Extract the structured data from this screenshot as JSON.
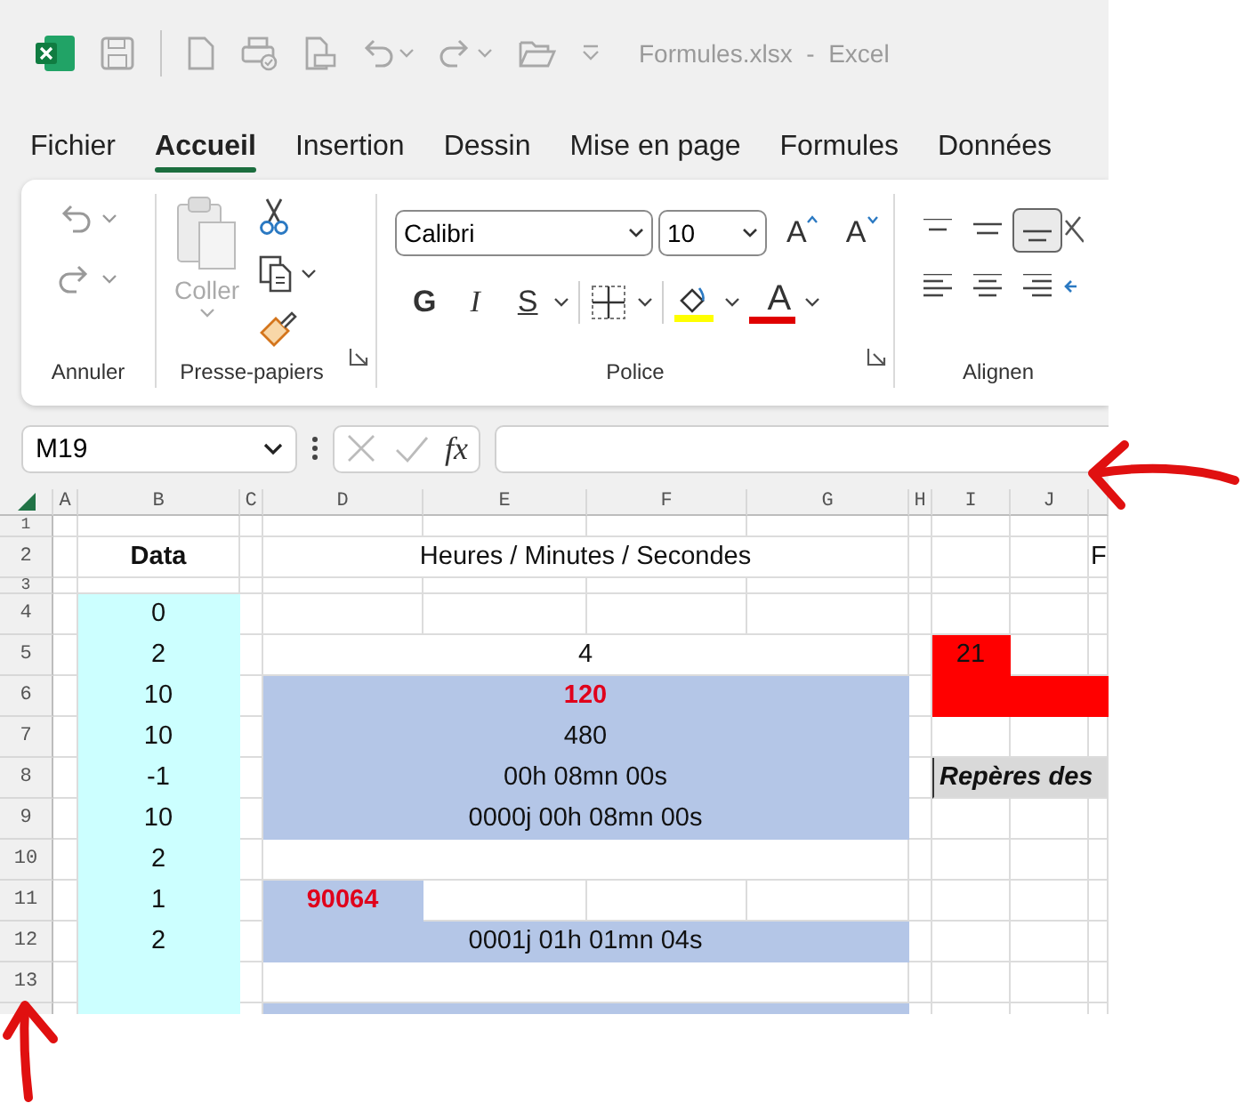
{
  "window": {
    "title": "Formules.xlsx  -  Excel"
  },
  "tabs": [
    {
      "label": "Fichier",
      "selected": false
    },
    {
      "label": "Accueil",
      "selected": true
    },
    {
      "label": "Insertion",
      "selected": false
    },
    {
      "label": "Dessin",
      "selected": false
    },
    {
      "label": "Mise en page",
      "selected": false
    },
    {
      "label": "Formules",
      "selected": false
    },
    {
      "label": "Données",
      "selected": false
    }
  ],
  "ribbon": {
    "undo": {
      "label": "Annuler"
    },
    "clipboard": {
      "label": "Presse-papiers",
      "paste": "Coller"
    },
    "font": {
      "label": "Police",
      "font_name": "Calibri",
      "font_size": "10",
      "grow": "A",
      "shrink": "A",
      "bold": "G",
      "italic": "I",
      "underline": "S",
      "font_color_letter": "A"
    },
    "alignment": {
      "label": "Alignen",
      "bottom_aligned": true
    }
  },
  "formula_bar": {
    "name_box": "M19",
    "fx": "fx"
  },
  "sheet": {
    "columns": [
      "A",
      "B",
      "C",
      "D",
      "E",
      "F",
      "G",
      "H",
      "I",
      "J"
    ],
    "rows": [
      {
        "label": "1",
        "kind": "compact",
        "cells": [
          {
            "kind": "empty"
          },
          {
            "kind": "empty"
          },
          {
            "kind": "empty"
          },
          {
            "kind": "empty"
          },
          {
            "kind": "empty"
          },
          {
            "kind": "empty"
          },
          {
            "kind": "empty"
          },
          {
            "kind": "empty"
          },
          {
            "kind": "empty"
          },
          {
            "kind": "empty"
          },
          {
            "kind": "empty"
          }
        ]
      },
      {
        "label": "2",
        "kind": "regular",
        "cells": [
          {
            "kind": "empty"
          },
          {
            "kind": "text",
            "text": "Data",
            "bold": true
          },
          {
            "kind": "empty"
          },
          {
            "kind": "text",
            "text": "Heures / Minutes / Secondes"
          },
          {
            "kind": "merged"
          },
          {
            "kind": "merged"
          },
          {
            "kind": "merged"
          },
          {
            "kind": "empty"
          },
          {
            "kind": "empty"
          },
          {
            "kind": "empty"
          },
          {
            "kind": "text",
            "text": "F",
            "left_aligned": true
          }
        ]
      },
      {
        "label": "3",
        "kind": "compact",
        "cells": [
          {
            "kind": "empty"
          },
          {
            "kind": "empty"
          },
          {
            "kind": "empty"
          },
          {
            "kind": "empty"
          },
          {
            "kind": "empty"
          },
          {
            "kind": "empty"
          },
          {
            "kind": "empty"
          },
          {
            "kind": "empty"
          },
          {
            "kind": "empty"
          },
          {
            "kind": "empty"
          },
          {
            "kind": "empty"
          }
        ]
      },
      {
        "label": "4",
        "kind": "regular",
        "cells": [
          {
            "kind": "empty"
          },
          {
            "kind": "text",
            "text": "0",
            "color": "#ccffff"
          },
          {
            "kind": "empty"
          },
          {
            "kind": "empty"
          },
          {
            "kind": "empty"
          },
          {
            "kind": "empty"
          },
          {
            "kind": "empty"
          },
          {
            "kind": "empty"
          },
          {
            "kind": "empty"
          },
          {
            "kind": "empty"
          },
          {
            "kind": "empty"
          }
        ]
      },
      {
        "label": "5",
        "kind": "regular",
        "cells": [
          {
            "kind": "empty"
          },
          {
            "kind": "text",
            "text": "2",
            "color": "#ccffff"
          },
          {
            "kind": "empty"
          },
          {
            "kind": "text",
            "text": "4"
          },
          {
            "kind": "merged"
          },
          {
            "kind": "merged"
          },
          {
            "kind": "merged"
          },
          {
            "kind": "empty"
          },
          {
            "kind": "text",
            "text": "21",
            "color": "#ff0000"
          },
          {
            "kind": "empty"
          },
          {
            "kind": "empty"
          }
        ]
      },
      {
        "label": "6",
        "kind": "regular",
        "cells": [
          {
            "kind": "empty"
          },
          {
            "kind": "text",
            "text": "10",
            "color": "#ccffff"
          },
          {
            "kind": "empty"
          },
          {
            "kind": "text",
            "text": "120",
            "color": "#b4c6e7",
            "bold": true,
            "highlighted": true
          },
          {
            "kind": "merged"
          },
          {
            "kind": "merged"
          },
          {
            "kind": "merged"
          },
          {
            "kind": "empty"
          },
          {
            "kind": "fill",
            "color": "#ff0000"
          },
          {
            "kind": "merged"
          },
          {
            "kind": "merged"
          }
        ]
      },
      {
        "label": "7",
        "kind": "regular",
        "cells": [
          {
            "kind": "empty"
          },
          {
            "kind": "text",
            "text": "10",
            "color": "#ccffff"
          },
          {
            "kind": "empty"
          },
          {
            "kind": "text",
            "text": "480",
            "color": "#b4c6e7"
          },
          {
            "kind": "merged"
          },
          {
            "kind": "merged"
          },
          {
            "kind": "merged"
          },
          {
            "kind": "empty"
          },
          {
            "kind": "empty"
          },
          {
            "kind": "empty"
          },
          {
            "kind": "empty"
          }
        ]
      },
      {
        "label": "8",
        "kind": "regular",
        "cells": [
          {
            "kind": "empty"
          },
          {
            "kind": "text",
            "text": "-1",
            "color": "#ccffff"
          },
          {
            "kind": "empty"
          },
          {
            "kind": "text",
            "text": "00h 08mn 00s",
            "color": "#b4c6e7"
          },
          {
            "kind": "merged"
          },
          {
            "kind": "merged"
          },
          {
            "kind": "merged"
          },
          {
            "kind": "empty"
          },
          {
            "kind": "text",
            "text": "Repères des",
            "color": "#d9d9d9",
            "bold": true,
            "italic": true,
            "left_aligned": true
          },
          {
            "kind": "empty"
          },
          {
            "kind": "empty"
          }
        ]
      },
      {
        "label": "9",
        "kind": "regular",
        "cells": [
          {
            "kind": "empty"
          },
          {
            "kind": "text",
            "text": "10",
            "color": "#ccffff"
          },
          {
            "kind": "empty"
          },
          {
            "kind": "text",
            "text": "0000j 00h 08mn 00s",
            "color": "#b4c6e7"
          },
          {
            "kind": "merged"
          },
          {
            "kind": "merged"
          },
          {
            "kind": "merged"
          },
          {
            "kind": "empty"
          },
          {
            "kind": "empty"
          },
          {
            "kind": "empty"
          },
          {
            "kind": "empty"
          }
        ]
      },
      {
        "label": "10",
        "kind": "regular",
        "cells": [
          {
            "kind": "empty"
          },
          {
            "kind": "text",
            "text": "2",
            "color": "#ccffff"
          },
          {
            "kind": "empty"
          },
          {
            "kind": "empty"
          },
          {
            "kind": "merged"
          },
          {
            "kind": "merged"
          },
          {
            "kind": "merged"
          },
          {
            "kind": "empty"
          },
          {
            "kind": "empty"
          },
          {
            "kind": "empty"
          },
          {
            "kind": "empty"
          }
        ]
      },
      {
        "label": "11",
        "kind": "regular",
        "cells": [
          {
            "kind": "empty"
          },
          {
            "kind": "text",
            "text": "1",
            "color": "#ccffff"
          },
          {
            "kind": "empty"
          },
          {
            "kind": "text",
            "text": "90064",
            "color": "#b4c6e7",
            "bold": true,
            "highlighted": true
          },
          {
            "kind": "empty"
          },
          {
            "kind": "empty"
          },
          {
            "kind": "empty"
          },
          {
            "kind": "empty"
          },
          {
            "kind": "empty"
          },
          {
            "kind": "empty"
          },
          {
            "kind": "empty"
          }
        ]
      },
      {
        "label": "12",
        "kind": "regular",
        "cells": [
          {
            "kind": "empty"
          },
          {
            "kind": "text",
            "text": "2",
            "color": "#ccffff"
          },
          {
            "kind": "empty"
          },
          {
            "kind": "text",
            "text": "0001j 01h 01mn 04s",
            "color": "#b4c6e7"
          },
          {
            "kind": "merged"
          },
          {
            "kind": "merged"
          },
          {
            "kind": "merged"
          },
          {
            "kind": "empty"
          },
          {
            "kind": "empty"
          },
          {
            "kind": "empty"
          },
          {
            "kind": "empty"
          }
        ]
      },
      {
        "label": "13",
        "kind": "regular",
        "cells": [
          {
            "kind": "empty"
          },
          {
            "kind": "fill",
            "color": "#ccffff"
          },
          {
            "kind": "empty"
          },
          {
            "kind": "empty"
          },
          {
            "kind": "merged"
          },
          {
            "kind": "merged"
          },
          {
            "kind": "merged"
          },
          {
            "kind": "empty"
          },
          {
            "kind": "empty"
          },
          {
            "kind": "empty"
          },
          {
            "kind": "empty"
          }
        ]
      },
      {
        "kind": "regular",
        "cells": [
          {
            "kind": "empty"
          },
          {
            "kind": "fill",
            "color": "#ccffff"
          },
          {
            "kind": "empty"
          },
          {
            "kind": "fill",
            "color": "#b4c6e7"
          },
          {
            "kind": "merged"
          },
          {
            "kind": "merged"
          },
          {
            "kind": "merged"
          },
          {
            "kind": "empty"
          },
          {
            "kind": "empty"
          },
          {
            "kind": "empty"
          },
          {
            "kind": "empty"
          }
        ]
      }
    ]
  }
}
